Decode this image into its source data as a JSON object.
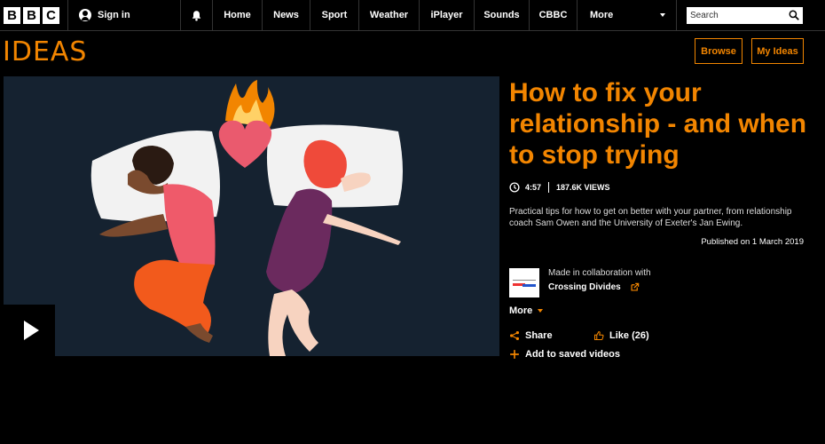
{
  "nav": {
    "logo_letters": [
      "B",
      "B",
      "C"
    ],
    "signin_label": "Sign in",
    "items": [
      "Home",
      "News",
      "Sport",
      "Weather",
      "iPlayer",
      "Sounds",
      "CBBC"
    ],
    "more_label": "More",
    "search_placeholder": "Search"
  },
  "header": {
    "section_title": "IDEAS",
    "browse_label": "Browse",
    "myideas_label": "My Ideas"
  },
  "article": {
    "title": "How to fix your relationship - and when to stop trying",
    "duration": "4:57",
    "views": "187.6K VIEWS",
    "description": "Practical tips for how to get on better with your partner, from relationship coach Sam Owen and the University of Exeter's Jan Ewing.",
    "published": "Published on 1 March 2019",
    "collab_intro": "Made in collaboration with",
    "collab_name": "Crossing Divides",
    "more_label": "More",
    "share_label": "Share",
    "like_label": "Like (26)",
    "save_label": "Add to saved videos"
  },
  "colors": {
    "accent": "#f28500",
    "background": "#000000"
  }
}
